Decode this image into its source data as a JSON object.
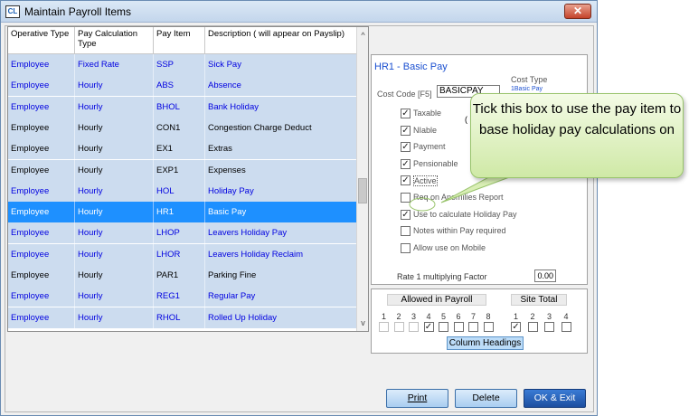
{
  "window": {
    "icon_text": "CL",
    "title": "Maintain Payroll Items",
    "close_glyph": "✕"
  },
  "grid": {
    "columns": [
      "Operative Type",
      "Pay Calculation Type",
      "Pay Item",
      "Description ( will appear on Payslip)"
    ],
    "rows": [
      {
        "operative": "Employee",
        "calc": "Fixed Rate",
        "item": "SSP",
        "desc": "Sick Pay",
        "style": "blue"
      },
      {
        "operative": "Employee",
        "calc": "Hourly",
        "item": "ABS",
        "desc": "Absence",
        "style": "blue"
      },
      {
        "operative": "Employee",
        "calc": "Hourly",
        "item": "BHOL",
        "desc": "Bank Holiday",
        "style": "blue"
      },
      {
        "operative": "Employee",
        "calc": "Hourly",
        "item": "CON1",
        "desc": "Congestion Charge Deduct",
        "style": "black"
      },
      {
        "operative": "Employee",
        "calc": "Hourly",
        "item": "EX1",
        "desc": "Extras",
        "style": "black"
      },
      {
        "operative": "Employee",
        "calc": "Hourly",
        "item": "EXP1",
        "desc": "Expenses",
        "style": "black"
      },
      {
        "operative": "Employee",
        "calc": "Hourly",
        "item": "HOL",
        "desc": "Holiday Pay",
        "style": "blue"
      },
      {
        "operative": "Employee",
        "calc": "Hourly",
        "item": "HR1",
        "desc": "Basic Pay",
        "style": "selected"
      },
      {
        "operative": "Employee",
        "calc": "Hourly",
        "item": "LHOP",
        "desc": "Leavers Holiday Pay",
        "style": "blue"
      },
      {
        "operative": "Employee",
        "calc": "Hourly",
        "item": "LHOR",
        "desc": "Leavers Holiday Reclaim",
        "style": "blue"
      },
      {
        "operative": "Employee",
        "calc": "Hourly",
        "item": "PAR1",
        "desc": "Parking Fine",
        "style": "black"
      },
      {
        "operative": "Employee",
        "calc": "Hourly",
        "item": "REG1",
        "desc": "Regular Pay",
        "style": "blue"
      },
      {
        "operative": "Employee",
        "calc": "Hourly",
        "item": "RHOL",
        "desc": "Rolled Up Holiday",
        "style": "blue"
      }
    ],
    "scroll_up": "^",
    "scroll_down": "v"
  },
  "details": {
    "title": "HR1 -  Basic Pay",
    "cost_code_label": "Cost Code [F5]",
    "cost_code_value": "BASICPAY",
    "cost_type_label": "Cost Type",
    "cost_type_value": "1Basic Pay",
    "payment_suffix": "(",
    "checkboxes": [
      {
        "label": "Taxable",
        "checked": true
      },
      {
        "label": "NIable",
        "checked": true
      },
      {
        "label": "Payment",
        "checked": true
      },
      {
        "label": "Pensionable",
        "checked": true
      },
      {
        "label": "Active",
        "checked": true
      },
      {
        "label": "Req on Anomilies Report",
        "checked": false
      },
      {
        "label": "Use to calculate Holiday Pay",
        "checked": true
      },
      {
        "label": "Notes within Pay required",
        "checked": false
      },
      {
        "label": "Allow use on Mobile",
        "checked": false
      }
    ],
    "rate_label": "Rate 1 multiplying Factor",
    "rate_value": "0.00"
  },
  "payroll": {
    "allowed_label": "Allowed in Payroll",
    "site_label": "Site Total",
    "allowed_numbers": [
      "1",
      "2",
      "3",
      "4",
      "5",
      "6",
      "7",
      "8"
    ],
    "allowed_checked": [
      false,
      false,
      false,
      true,
      false,
      false,
      false,
      false
    ],
    "site_numbers": [
      "1",
      "2",
      "3",
      "4"
    ],
    "site_checked": [
      true,
      false,
      false,
      false
    ],
    "column_headings_label": "Column Headings"
  },
  "buttons": {
    "print": "Print",
    "delete": "Delete",
    "ok_exit": "OK & Exit"
  },
  "callout": {
    "text": "Tick this box to use the pay item to base holiday pay calculations on"
  },
  "colors": {
    "row_bg": "#ccdcef",
    "selected_bg": "#1e90ff",
    "blue_text": "#0000e0",
    "callout_bg": "#dff0bf"
  }
}
